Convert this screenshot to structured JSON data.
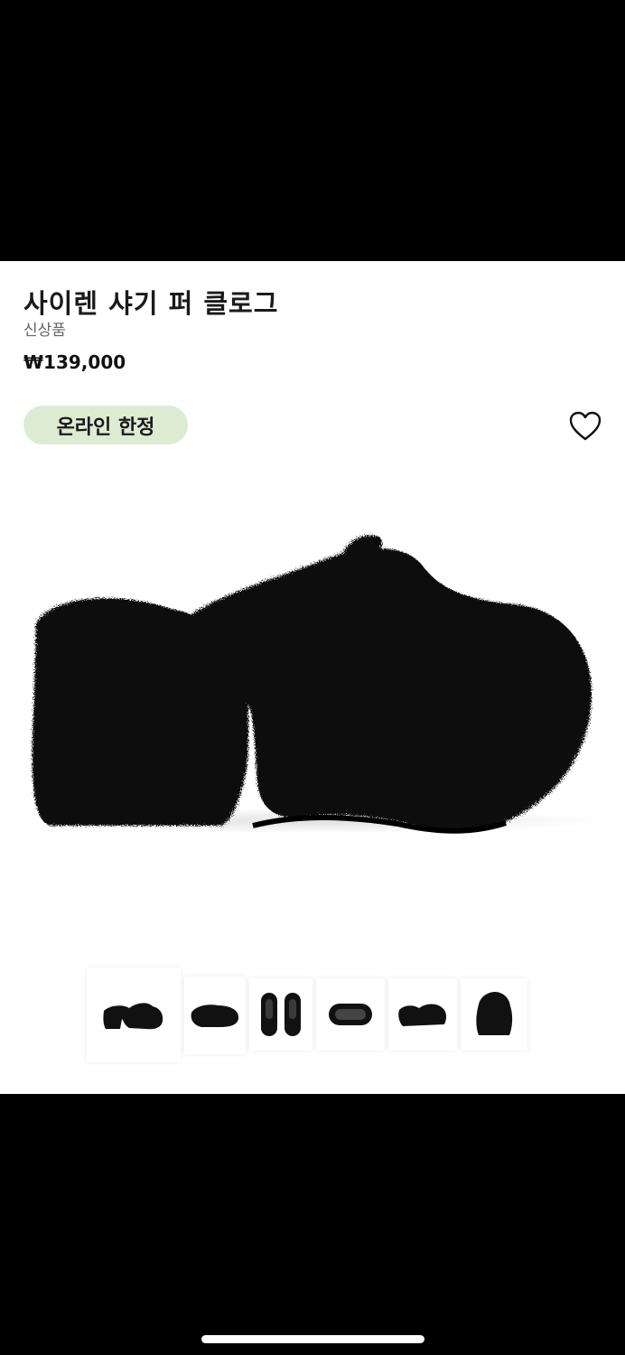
{
  "product": {
    "title": "사이렌 샤기 퍼 클로그",
    "subtitle": "신상품",
    "price": "₩139,000",
    "badge": "온라인 한정"
  },
  "icons": {
    "favorite": "heart-outline-icon"
  },
  "colors": {
    "badge_bg": "#dcebd1",
    "page_bg": "#ffffff",
    "product": "#111111"
  },
  "gallery": {
    "thumbnails": [
      {
        "view": "side"
      },
      {
        "view": "angle"
      },
      {
        "view": "top-pair"
      },
      {
        "view": "sole"
      },
      {
        "view": "side-2"
      },
      {
        "view": "back"
      }
    ],
    "selected_index": 0
  }
}
